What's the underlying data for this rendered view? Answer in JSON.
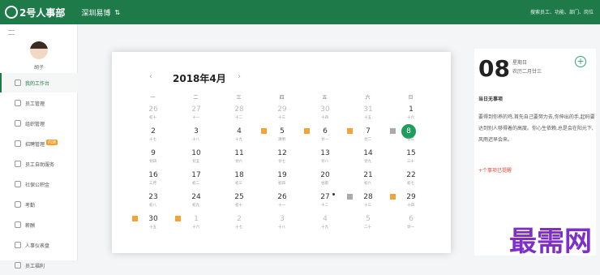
{
  "topbar": {
    "logo": "2号人事部",
    "company": "深圳易博",
    "swap": "⇅",
    "search_placeholder": "搜索员工、功能、部门、岗位"
  },
  "sidebar": {
    "username": "胡子",
    "items": [
      {
        "label": "我的工作台",
        "active": true
      },
      {
        "label": "员工管理"
      },
      {
        "label": "组织管理"
      },
      {
        "label": "招聘管理",
        "badge": "内测"
      },
      {
        "label": "员工自助服务"
      },
      {
        "label": "社保公积金"
      },
      {
        "label": "考勤"
      },
      {
        "label": "薪酬"
      },
      {
        "label": "人事仪表盘"
      },
      {
        "label": "员工福利"
      }
    ]
  },
  "calendar": {
    "month_title": "2018年4月",
    "weekdays": [
      "一",
      "二",
      "三",
      "四",
      "五",
      "六",
      "日"
    ],
    "days": [
      {
        "n": "26",
        "l": "初十",
        "muted": true
      },
      {
        "n": "27",
        "l": "十一",
        "muted": true
      },
      {
        "n": "28",
        "l": "十二",
        "muted": true
      },
      {
        "n": "29",
        "l": "十三",
        "muted": true
      },
      {
        "n": "30",
        "l": "十四",
        "muted": true
      },
      {
        "n": "31",
        "l": "十五",
        "muted": true
      },
      {
        "n": "1",
        "l": "十六"
      },
      {
        "n": "2",
        "l": "十七"
      },
      {
        "n": "3",
        "l": "十八"
      },
      {
        "n": "4",
        "l": "十九"
      },
      {
        "n": "5",
        "l": "清明",
        "event": true
      },
      {
        "n": "6",
        "l": "廿一",
        "event": true
      },
      {
        "n": "7",
        "l": "廿二",
        "event": true
      },
      {
        "n": "8",
        "l": "廿三",
        "event": "gray",
        "selected": true
      },
      {
        "n": "9",
        "l": "廿四"
      },
      {
        "n": "10",
        "l": "廿五"
      },
      {
        "n": "11",
        "l": "廿六"
      },
      {
        "n": "12",
        "l": "廿七"
      },
      {
        "n": "13",
        "l": "廿八"
      },
      {
        "n": "14",
        "l": "廿九"
      },
      {
        "n": "15",
        "l": "三十"
      },
      {
        "n": "16",
        "l": "三月"
      },
      {
        "n": "17",
        "l": "初二"
      },
      {
        "n": "18",
        "l": "初三"
      },
      {
        "n": "19",
        "l": "初四"
      },
      {
        "n": "20",
        "l": "谷雨"
      },
      {
        "n": "21",
        "l": "初六"
      },
      {
        "n": "22",
        "l": "初七"
      },
      {
        "n": "23",
        "l": "初八"
      },
      {
        "n": "24",
        "l": "初九"
      },
      {
        "n": "25",
        "l": "初十"
      },
      {
        "n": "26",
        "l": "十一"
      },
      {
        "n": "27",
        "l": "十二",
        "dot": true
      },
      {
        "n": "28",
        "l": "十三",
        "event": "gray"
      },
      {
        "n": "29",
        "l": "十四",
        "event": true
      },
      {
        "n": "30",
        "l": "十五",
        "event": true
      },
      {
        "n": "1",
        "l": "十六",
        "muted": true,
        "event": true
      },
      {
        "n": "2",
        "l": "十七",
        "muted": true
      },
      {
        "n": "3",
        "l": "十八",
        "muted": true
      },
      {
        "n": "4",
        "l": "十九",
        "muted": true
      },
      {
        "n": "5",
        "l": "二十",
        "muted": true
      },
      {
        "n": "6",
        "l": "廿一",
        "muted": true
      }
    ]
  },
  "right_panel": {
    "big_day": "08",
    "weekname": "星期日",
    "lunar": "农历二月廿三",
    "add": "+",
    "notice_title": "当日无事项",
    "notice_body": "要得到你养的鸡,首先自己要努力去,你伸出的手,起码要达到别人够得着的高度。你心生依赖,总是会在阳光下,风雨迟早会来。",
    "reminder": "+个事项已提醒"
  },
  "watermark": "最需网"
}
